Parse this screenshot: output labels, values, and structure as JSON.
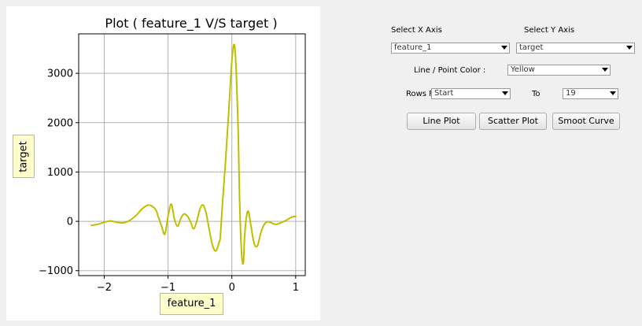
{
  "chart_data": {
    "type": "line",
    "title": "Plot ( feature_1 V/S target )",
    "xlabel": "feature_1",
    "ylabel": "target",
    "xlim": [
      -2.4,
      1.15
    ],
    "ylim": [
      -1100,
      3800
    ],
    "xticks": [
      -2,
      -1,
      0,
      1
    ],
    "xtick_labels": [
      "−2",
      "−1",
      "0",
      "1"
    ],
    "yticks": [
      -1000,
      0,
      1000,
      2000,
      3000
    ],
    "ytick_labels": [
      "−1000",
      "0",
      "1000",
      "2000",
      "3000"
    ],
    "grid": true,
    "line_color": "#bfbf00",
    "series": [
      {
        "x": [
          -2.2,
          -2.1,
          -2.0,
          -1.9,
          -1.8,
          -1.7,
          -1.6,
          -1.5,
          -1.4,
          -1.3,
          -1.2,
          -1.15,
          -1.1,
          -1.05,
          -1.0,
          -0.95,
          -0.9,
          -0.85,
          -0.8,
          -0.75,
          -0.7,
          -0.65,
          -0.6,
          -0.55,
          -0.5,
          -0.45,
          -0.4,
          -0.35,
          -0.3,
          -0.25,
          -0.2,
          -0.18,
          -0.15,
          -0.1,
          -0.05,
          0.0,
          0.04,
          0.07,
          0.1,
          0.12,
          0.15,
          0.18,
          0.2,
          0.23,
          0.26,
          0.3,
          0.35,
          0.4,
          0.45,
          0.5,
          0.55,
          0.6,
          0.65,
          0.7,
          0.75,
          0.8,
          0.85,
          0.9,
          0.95,
          1.0
        ],
        "y": [
          -80,
          -60,
          -20,
          10,
          -20,
          -30,
          20,
          120,
          260,
          330,
          250,
          80,
          -100,
          -260,
          100,
          350,
          50,
          -100,
          60,
          150,
          110,
          0,
          -150,
          0,
          250,
          330,
          150,
          -200,
          -500,
          -600,
          -430,
          -300,
          300,
          1200,
          2200,
          3250,
          3580,
          3000,
          1800,
          500,
          -600,
          -850,
          -300,
          100,
          200,
          -100,
          -450,
          -500,
          -250,
          -80,
          -10,
          -20,
          -50,
          -60,
          -40,
          -10,
          20,
          60,
          90,
          100
        ]
      }
    ]
  },
  "controls": {
    "select_x_label": "Select X Axis",
    "select_y_label": "Select Y Axis",
    "x_axis_value": "feature_1",
    "y_axis_value": "target",
    "color_label": "Line / Point Color :",
    "color_value": "Yellow",
    "rows_from_label": "Rows From",
    "rows_from_value": "Start",
    "to_label": "To",
    "to_value": "19",
    "line_plot_button": "Line Plot",
    "scatter_plot_button": "Scatter Plot",
    "smooth_curve_button": "Smoot Curve"
  }
}
